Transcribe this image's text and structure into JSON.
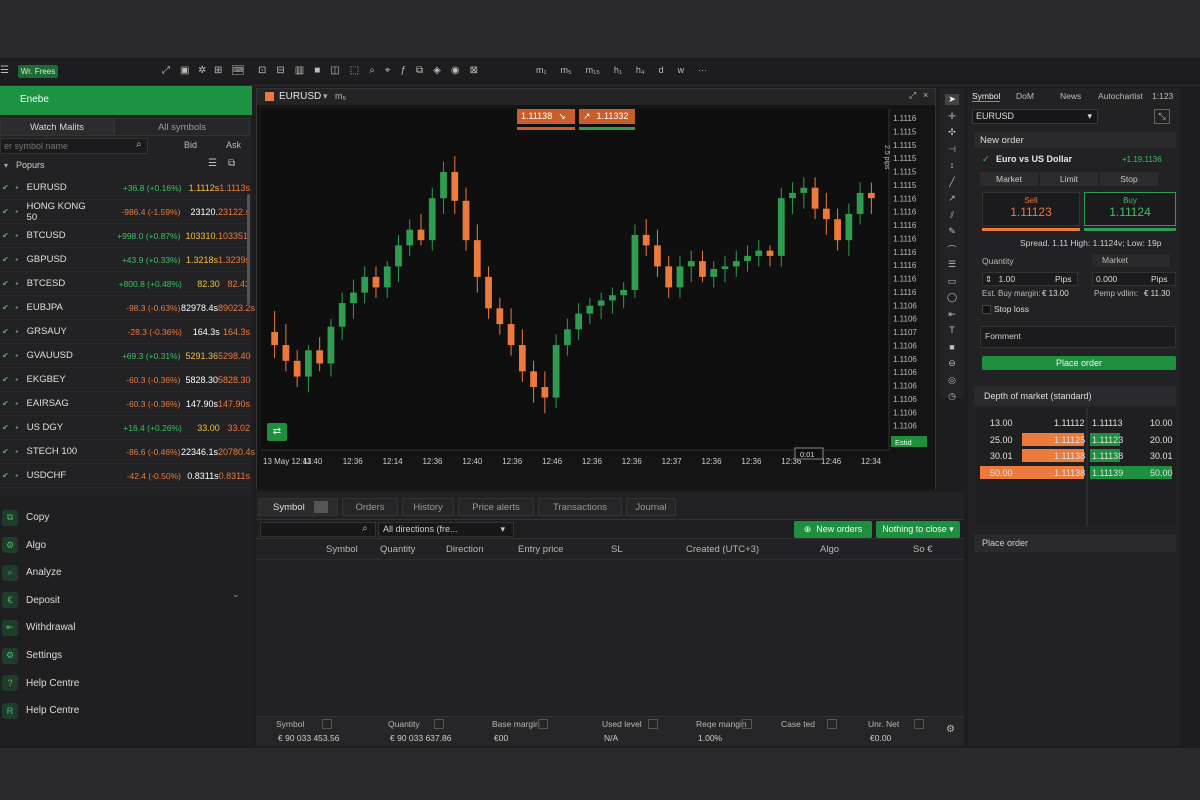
{
  "topbar": {
    "badge": "Wr. Frees",
    "icons_left": [
      "expand-icon",
      "layout-icon",
      "settings-icon",
      "grid-icon"
    ],
    "toolbar_icons": [
      "crosshair-icon",
      "window-icon",
      "candle-icon",
      "bar-icon",
      "line-icon",
      "chart-type-icon",
      "zoom-icon",
      "zoom-in-icon",
      "indicator-icon",
      "objects-icon",
      "layers-icon",
      "eye-icon",
      "lock-icon"
    ],
    "timeframes": [
      "m₁",
      "m₅",
      "m₁₅",
      "h₁",
      "h₄",
      "d",
      "w",
      "···"
    ]
  },
  "left": {
    "active_section": "Enebe",
    "tabs": [
      "Watch Malits",
      "All symbols"
    ],
    "search_placeholder": "er symbol name",
    "col_bid": "Bid",
    "col_ask": "Ask",
    "group": "Popurs",
    "rows": [
      {
        "sym": "EURUSD",
        "chg": "+36.8 (+0.16%)",
        "bid": "1.1112s",
        "ask": "1.1113s",
        "dir": "up"
      },
      {
        "sym": "HONG KONG 50",
        "chg": "-986.4 (-1.59%)",
        "bid": "23120.",
        "ask": "23122.s",
        "dir": "down"
      },
      {
        "sym": "BTCUSD",
        "chg": "+998.0 (+0.87%)",
        "bid": "103310.",
        "ask": "103351.",
        "dir": "up"
      },
      {
        "sym": "GBPUSD",
        "chg": "+43.9 (+0.33%)",
        "bid": "1.3218s",
        "ask": "1.3239s",
        "dir": "up"
      },
      {
        "sym": "BTCESD",
        "chg": "+800.8 (+0.48%)",
        "bid": "82.30",
        "ask": "82.43",
        "dir": "up"
      },
      {
        "sym": "EUBJPA",
        "chg": "-98.3 (-0.63%)",
        "bid": "82978.4s",
        "ask": "89023.2s",
        "dir": "down"
      },
      {
        "sym": "GRSAUY",
        "chg": "-28.3 (-0.36%)",
        "bid": "164.3s",
        "ask": "164.3s",
        "dir": "down"
      },
      {
        "sym": "GVAUUSD",
        "chg": "+69.3 (+0.31%)",
        "bid": "5291.36",
        "ask": "5298.40",
        "dir": "up"
      },
      {
        "sym": "EKGBEY",
        "chg": "-60.3 (-0.36%)",
        "bid": "5828.30",
        "ask": "5828.30",
        "dir": "down"
      },
      {
        "sym": "EAIRSAG",
        "chg": "-60.3 (-0.36%)",
        "bid": "147.90s",
        "ask": "147.90s",
        "dir": "down"
      },
      {
        "sym": "US DGY",
        "chg": "+16.4 (+0.26%)",
        "bid": "33.00",
        "ask": "33.02",
        "dir": "up"
      },
      {
        "sym": "STECH 100",
        "chg": "-86.6 (-0.46%)",
        "bid": "22346.1s",
        "ask": "20780.4s",
        "dir": "down"
      },
      {
        "sym": "USDCHF",
        "chg": "-42.4 (-0.50%)",
        "bid": "0.8311s",
        "ask": "0.8311s",
        "dir": "down"
      }
    ],
    "menu": [
      {
        "label": "Copy",
        "icon": "copy-icon",
        "glyph": "⧉"
      },
      {
        "label": "Algo",
        "icon": "algo-icon",
        "glyph": "⚙"
      },
      {
        "label": "Analyze",
        "icon": "analyze-icon",
        "glyph": "⌕"
      },
      {
        "label": "Deposit",
        "icon": "deposit-icon",
        "glyph": "€"
      },
      {
        "label": "Withdrawal",
        "icon": "withdrawal-icon",
        "glyph": "⇤"
      },
      {
        "label": "Settings",
        "icon": "settings-icon",
        "glyph": "⚙"
      },
      {
        "label": "Help Centre",
        "icon": "help-icon",
        "glyph": "?"
      },
      {
        "label": "Help Centre",
        "icon": "help-centre-icon",
        "glyph": "R"
      }
    ]
  },
  "chart": {
    "symbol": "EURUSD",
    "timeframe": "m₅",
    "sell_price": "1.11138",
    "buy_price": "1.11332",
    "y_axis_label": "2.5 pips",
    "y_ticks": [
      "1.1116",
      "1.1115",
      "1.1115",
      "1.1115",
      "1.1115",
      "1.1115",
      "1.1116",
      "1.1116",
      "1.1116",
      "1.1116",
      "1.1116",
      "1.1116",
      "1.1116",
      "1.1116",
      "1.1106",
      "1.1106",
      "1.1107",
      "1.1106",
      "1.1106",
      "1.1106",
      "1.1106",
      "1.1106",
      "1.1106",
      "1.1106",
      "1.1106"
    ],
    "x_ticks": [
      "13 May 12:43",
      "11:40",
      "12:36",
      "12:14",
      "12:36",
      "12:40",
      "12:36",
      "12:46",
      "12:36",
      "12:36",
      "12:37",
      "12:36",
      "12:36",
      "12:36",
      "12:46",
      "12:34"
    ],
    "crosshair_label": "0:01",
    "edge_label": "Estid",
    "colors": {
      "up": "#2f9d4f",
      "down": "#ec7a3c"
    }
  },
  "chart_data": {
    "type": "candlestick",
    "series": [
      {
        "o": 1.11085,
        "h": 1.11093,
        "l": 1.11075,
        "c": 1.1108
      },
      {
        "o": 1.1108,
        "h": 1.11088,
        "l": 1.1107,
        "c": 1.11074
      },
      {
        "o": 1.11074,
        "h": 1.11078,
        "l": 1.11064,
        "c": 1.11068
      },
      {
        "o": 1.11068,
        "h": 1.1108,
        "l": 1.11062,
        "c": 1.11078
      },
      {
        "o": 1.11078,
        "h": 1.11083,
        "l": 1.1107,
        "c": 1.11073
      },
      {
        "o": 1.11073,
        "h": 1.1109,
        "l": 1.11068,
        "c": 1.11087
      },
      {
        "o": 1.11087,
        "h": 1.111,
        "l": 1.11082,
        "c": 1.11096
      },
      {
        "o": 1.11096,
        "h": 1.11105,
        "l": 1.1109,
        "c": 1.111
      },
      {
        "o": 1.111,
        "h": 1.1111,
        "l": 1.11096,
        "c": 1.11106
      },
      {
        "o": 1.11106,
        "h": 1.1111,
        "l": 1.11098,
        "c": 1.11102
      },
      {
        "o": 1.11102,
        "h": 1.11112,
        "l": 1.11098,
        "c": 1.1111
      },
      {
        "o": 1.1111,
        "h": 1.11122,
        "l": 1.11104,
        "c": 1.11118
      },
      {
        "o": 1.11118,
        "h": 1.11128,
        "l": 1.11114,
        "c": 1.11124
      },
      {
        "o": 1.11124,
        "h": 1.1113,
        "l": 1.11118,
        "c": 1.1112
      },
      {
        "o": 1.1112,
        "h": 1.1114,
        "l": 1.11116,
        "c": 1.11136
      },
      {
        "o": 1.11136,
        "h": 1.1115,
        "l": 1.1113,
        "c": 1.11146
      },
      {
        "o": 1.11146,
        "h": 1.11152,
        "l": 1.1113,
        "c": 1.11135
      },
      {
        "o": 1.11135,
        "h": 1.1114,
        "l": 1.11116,
        "c": 1.1112
      },
      {
        "o": 1.1112,
        "h": 1.11126,
        "l": 1.111,
        "c": 1.11106
      },
      {
        "o": 1.11106,
        "h": 1.1111,
        "l": 1.1109,
        "c": 1.11094
      },
      {
        "o": 1.11094,
        "h": 1.11098,
        "l": 1.11084,
        "c": 1.11088
      },
      {
        "o": 1.11088,
        "h": 1.11094,
        "l": 1.11076,
        "c": 1.1108
      },
      {
        "o": 1.1108,
        "h": 1.11086,
        "l": 1.11066,
        "c": 1.1107
      },
      {
        "o": 1.1107,
        "h": 1.11074,
        "l": 1.11058,
        "c": 1.11064
      },
      {
        "o": 1.11064,
        "h": 1.1107,
        "l": 1.11054,
        "c": 1.1106
      },
      {
        "o": 1.1106,
        "h": 1.11084,
        "l": 1.11056,
        "c": 1.1108
      },
      {
        "o": 1.1108,
        "h": 1.1109,
        "l": 1.11076,
        "c": 1.11086
      },
      {
        "o": 1.11086,
        "h": 1.11096,
        "l": 1.11082,
        "c": 1.11092
      },
      {
        "o": 1.11092,
        "h": 1.11098,
        "l": 1.11088,
        "c": 1.11095
      },
      {
        "o": 1.11095,
        "h": 1.111,
        "l": 1.1109,
        "c": 1.11097
      },
      {
        "o": 1.11097,
        "h": 1.11102,
        "l": 1.11092,
        "c": 1.11099
      },
      {
        "o": 1.11099,
        "h": 1.11104,
        "l": 1.11094,
        "c": 1.11101
      },
      {
        "o": 1.11101,
        "h": 1.11126,
        "l": 1.11098,
        "c": 1.11122
      },
      {
        "o": 1.11122,
        "h": 1.11128,
        "l": 1.11114,
        "c": 1.11118
      },
      {
        "o": 1.11118,
        "h": 1.11124,
        "l": 1.11106,
        "c": 1.1111
      },
      {
        "o": 1.1111,
        "h": 1.11114,
        "l": 1.11098,
        "c": 1.11102
      },
      {
        "o": 1.11102,
        "h": 1.11114,
        "l": 1.11098,
        "c": 1.1111
      },
      {
        "o": 1.1111,
        "h": 1.11116,
        "l": 1.11104,
        "c": 1.11112
      },
      {
        "o": 1.11112,
        "h": 1.11116,
        "l": 1.11104,
        "c": 1.11106
      },
      {
        "o": 1.11106,
        "h": 1.11112,
        "l": 1.11102,
        "c": 1.11109
      },
      {
        "o": 1.11109,
        "h": 1.11114,
        "l": 1.11104,
        "c": 1.1111
      },
      {
        "o": 1.1111,
        "h": 1.11116,
        "l": 1.11106,
        "c": 1.11112
      },
      {
        "o": 1.11112,
        "h": 1.11118,
        "l": 1.11108,
        "c": 1.11114
      },
      {
        "o": 1.11114,
        "h": 1.1112,
        "l": 1.1111,
        "c": 1.11116
      },
      {
        "o": 1.11116,
        "h": 1.11118,
        "l": 1.1111,
        "c": 1.11114
      },
      {
        "o": 1.11114,
        "h": 1.1114,
        "l": 1.1111,
        "c": 1.11136
      },
      {
        "o": 1.11136,
        "h": 1.11142,
        "l": 1.1113,
        "c": 1.11138
      },
      {
        "o": 1.11138,
        "h": 1.11144,
        "l": 1.11132,
        "c": 1.1114
      },
      {
        "o": 1.1114,
        "h": 1.11144,
        "l": 1.11128,
        "c": 1.11132
      },
      {
        "o": 1.11132,
        "h": 1.11138,
        "l": 1.11122,
        "c": 1.11128
      },
      {
        "o": 1.11128,
        "h": 1.11132,
        "l": 1.11116,
        "c": 1.1112
      },
      {
        "o": 1.1112,
        "h": 1.11134,
        "l": 1.11114,
        "c": 1.1113
      },
      {
        "o": 1.1113,
        "h": 1.11142,
        "l": 1.11126,
        "c": 1.11138
      },
      {
        "o": 1.11138,
        "h": 1.11142,
        "l": 1.1113,
        "c": 1.11136
      }
    ],
    "ylim": [
      1.1104,
      1.1117
    ]
  },
  "bottom": {
    "tabs": [
      "Symbol",
      "Orders",
      "History",
      "Price alerts",
      "Transactions",
      "Journal"
    ],
    "filter_value": "All directions (fre...",
    "new_order_btn": "New orders",
    "nothing_btn": "Nothing to close",
    "columns": [
      "Symbol",
      "Quantity",
      "Direction",
      "Entry price",
      "SL",
      "Created (UTC+3)",
      "Algo",
      "So €"
    ],
    "footer_labels": [
      "Symbol",
      "Quantity",
      "Base margin",
      "Used level",
      "Reqe mangin",
      "Case ted",
      "Unr. Net"
    ],
    "footer_values": [
      "€ 90 033 453.56",
      "€ 90 033 637.86",
      "€00",
      "N/A",
      "1.00%",
      "",
      "€0.00"
    ]
  },
  "right": {
    "tabs": [
      "Symbol",
      "DoM",
      "News",
      "Autochartist",
      "1:123"
    ],
    "symbol_select": "EURUSD",
    "new_order_title": "New order",
    "instrument_name": "Euro vs US Dollar",
    "instrument_change": "+1.19.1136",
    "order_types": [
      "Market",
      "Limit",
      "Stop"
    ],
    "sell_label": "Sell",
    "sell_price": "1.11123",
    "buy_label": "Buy",
    "buy_price": "1.11124",
    "spread_text": "Spread. 1.11 High: 1.1124v; Low: 19p",
    "quantity_label": "Quantity",
    "market_label": "Market",
    "quantity_value": "1.00",
    "pips_left": "Pips",
    "pips_value": "0.000",
    "pips_right": "Pips",
    "est_margin_label": "Est. Buy margin:",
    "est_margin_value": "€ 13.00",
    "pip_value_label": "Pemp vdlim:",
    "pip_value_value": "€ 11.30",
    "stop_loss": "Stop loss",
    "comment": "Fomment",
    "place_order_btn": "Place order",
    "dom_title": "Depth of market (standard)",
    "dom_rows": [
      {
        "lq": "13.00",
        "lp": "1.11112",
        "rp": "1.11113",
        "rq": "10.00",
        "hl": false,
        "hr": false
      },
      {
        "lq": "25.00",
        "lp": "1.11125",
        "rp": "1.11123",
        "rq": "20.00",
        "hl": true,
        "hr": true
      },
      {
        "lq": "30.01",
        "lp": "1.11138",
        "rp": "1.11138",
        "rq": "30.01",
        "hl": true,
        "hr": true
      },
      {
        "lq": "50.00",
        "lp": "1.11138",
        "rp": "1.11139",
        "rq": "50.00",
        "hl": true,
        "hr": true
      }
    ],
    "place_order_section": "Place order"
  }
}
